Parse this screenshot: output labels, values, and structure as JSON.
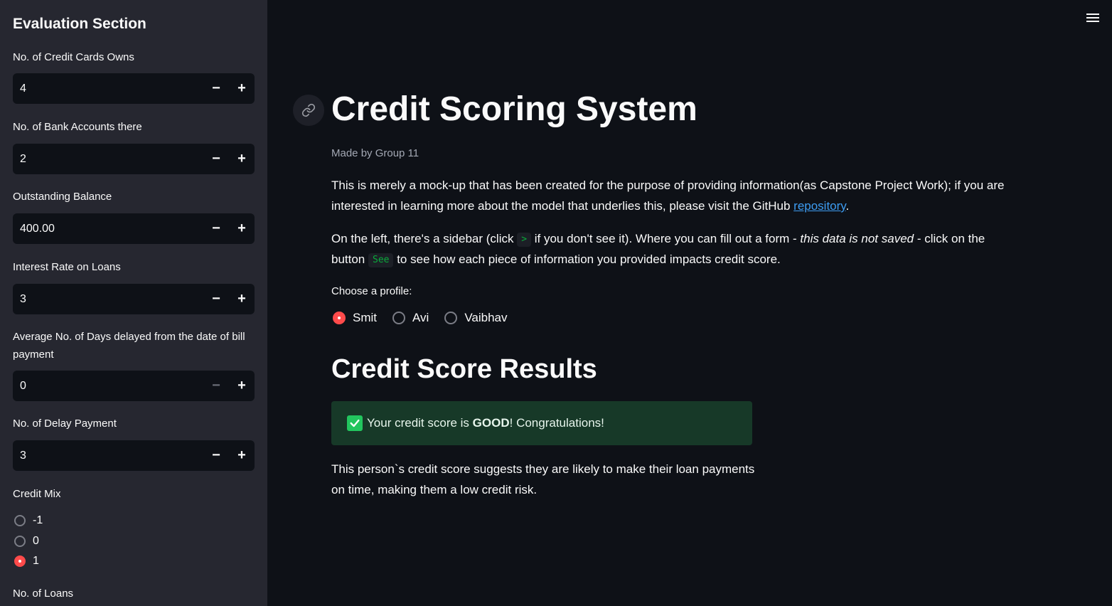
{
  "sidebar": {
    "title": "Evaluation Section",
    "fields": [
      {
        "label": "No. of Credit Cards Owns",
        "value": "4"
      },
      {
        "label": "No. of Bank Accounts there",
        "value": "2"
      },
      {
        "label": "Outstanding Balance",
        "value": "400.00"
      },
      {
        "label": "Interest Rate on Loans",
        "value": "3"
      },
      {
        "label": "Average No. of Days delayed from the date of bill payment",
        "value": "0"
      },
      {
        "label": "No. of Delay Payment",
        "value": "3"
      }
    ],
    "stepper_minus": "−",
    "stepper_plus": "+",
    "credit_mix": {
      "label": "Credit Mix",
      "options": [
        "-1",
        "0",
        "1"
      ],
      "selected": "1"
    },
    "loans_label": "No. of Loans"
  },
  "main": {
    "title": "Credit Scoring System",
    "made_by": "Made by Group 11",
    "intro_text": "This is merely a mock-up that has been created for the purpose of providing information(as Capstone Project Work); if you are interested in learning more about the model that underlies this, please visit the GitHub ",
    "intro_link": "repository",
    "intro_end": ".",
    "sidebar_text_1": "On the left, there's a sidebar (click ",
    "sidebar_chip": ">",
    "sidebar_text_2": " if you don't see it). Where you can fill out a form - ",
    "sidebar_italic": "this data is not saved",
    "sidebar_text_3": " - click on the button ",
    "see_chip": "See",
    "sidebar_text_4": " to see how each piece of information you provided impacts credit score.",
    "choose_label": "Choose a profile:",
    "profiles": [
      "Smit",
      "Avi",
      "Vaibhav"
    ],
    "selected_profile": "Smit",
    "results_title": "Credit Score Results",
    "success_prefix": "Your credit score is ",
    "success_bold": "GOOD",
    "success_suffix": "! Congratulations!",
    "result_text": "This person`s credit score suggests they are likely to make their loan payments on time, making them a low credit risk."
  },
  "colors": {
    "accent": "#ff4b4b",
    "success_bg": "#173928",
    "link": "#3d9df3"
  }
}
